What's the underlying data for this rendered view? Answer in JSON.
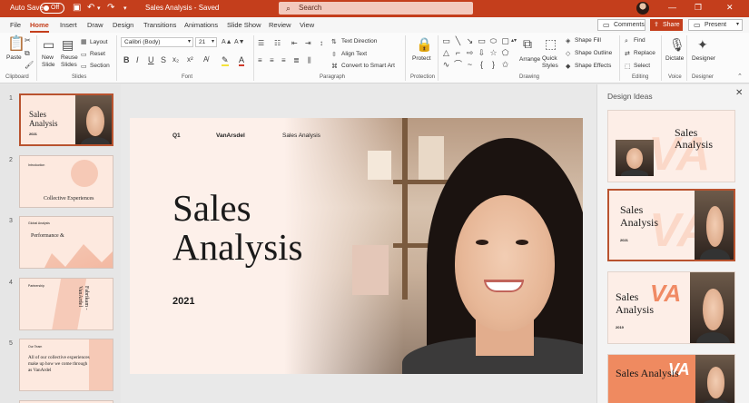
{
  "titlebar": {
    "autosave_label": "Auto Save",
    "autosave_state": "Off",
    "doc_title": "Sales Analysis - Saved",
    "search_placeholder": "Search"
  },
  "tabs": [
    "File",
    "Home",
    "Insert",
    "Draw",
    "Design",
    "Transitions",
    "Animations",
    "Slide Show",
    "Review",
    "View"
  ],
  "active_tab": "Home",
  "header_buttons": {
    "comments": "Comments",
    "share": "Share",
    "present": "Present"
  },
  "ribbon": {
    "clipboard": {
      "paste": "Paste",
      "label": "Clipboard"
    },
    "slides": {
      "new_slide": "New Slide",
      "reuse_slides": "Reuse Slides",
      "layout": "Layout",
      "reset": "Reset",
      "section": "Section",
      "label": "Slides"
    },
    "font": {
      "family": "Calibri (Body)",
      "size": "21",
      "label": "Font"
    },
    "paragraph": {
      "text_direction": "Text Direction",
      "align_text": "Align Text",
      "convert_smartart": "Convert to Smart Art",
      "label": "Paragraph"
    },
    "protection": {
      "protect": "Protect",
      "label": "Protection"
    },
    "drawing": {
      "arrange": "Arrange",
      "quick_styles": "Quick Styles",
      "shape_fill": "Shape Fill",
      "shape_outline": "Shape Outline",
      "shape_effects": "Shape Effects",
      "label": "Drawing"
    },
    "editing": {
      "find": "Find",
      "replace": "Replace",
      "select": "Select",
      "label": "Editing"
    },
    "voice": {
      "dictate": "Dictate",
      "label": "Voice"
    },
    "designer": {
      "designer": "Designer",
      "label": "Designer"
    }
  },
  "thumbnails": [
    {
      "num": "1",
      "title": "Sales Analysis",
      "sub": "2021"
    },
    {
      "num": "2",
      "title": "Collective Experiences",
      "sub": "Introduction"
    },
    {
      "num": "3",
      "title": "Performance &",
      "sub": "Global Analysis"
    },
    {
      "num": "4",
      "title": "Fabrikam - VanArdel",
      "sub": "Partnership"
    },
    {
      "num": "5",
      "title": "All of our collective experiences make up how we come through as VanArdel",
      "sub": "Our Team"
    }
  ],
  "slide": {
    "top_left": "Q1",
    "top_mid": "VanArsdel",
    "top_right": "Sales Analysis",
    "title_line1": "Sales",
    "title_line2": "Analysis",
    "year": "2021"
  },
  "design_ideas": {
    "title": "Design Ideas",
    "ideas": [
      {
        "title": "Sales Analysis"
      },
      {
        "title": "Sales Analysis",
        "year": "2021"
      },
      {
        "title": "Sales Analysis",
        "year": "2019"
      },
      {
        "title": "Sales Analysis"
      }
    ]
  },
  "colors": {
    "accent": "#c43e1c",
    "slide_bg": "#fdf0ea"
  }
}
